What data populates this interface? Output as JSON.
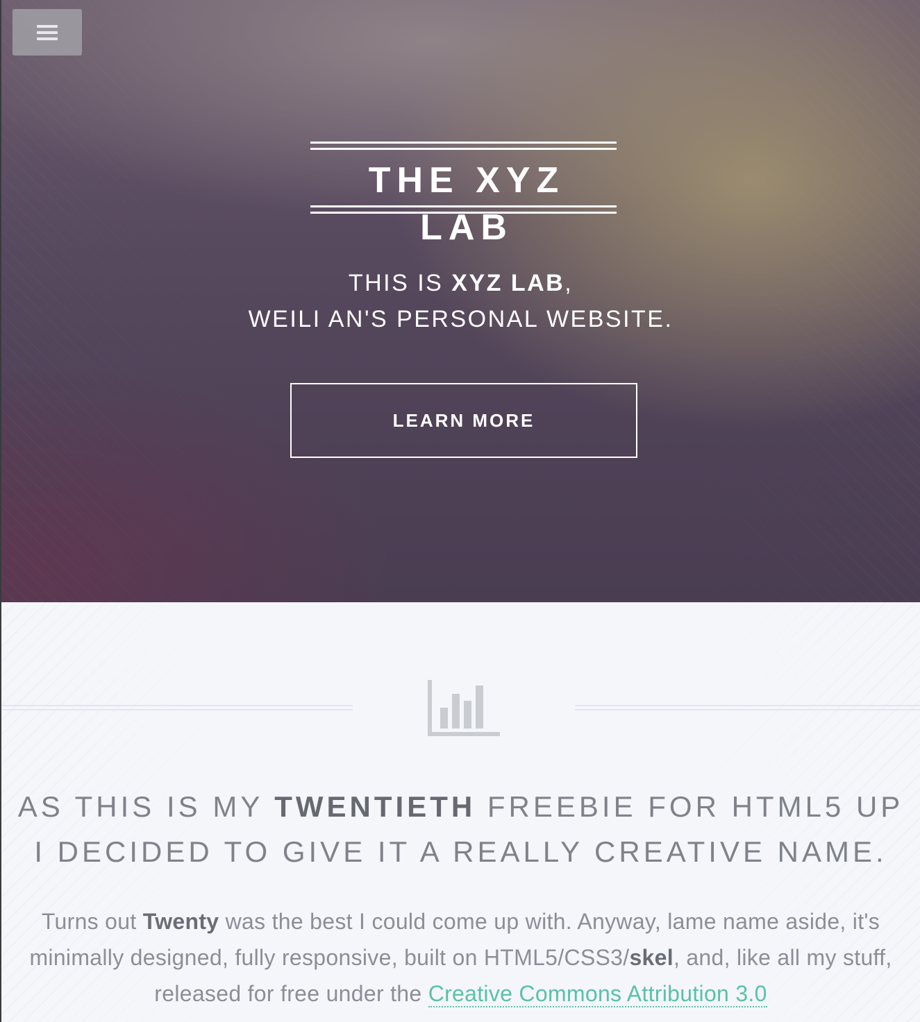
{
  "nav": {
    "menu_icon": "hamburger-menu-icon"
  },
  "hero": {
    "logo_title": "THE XYZ LAB",
    "tagline_line1_prefix": "THIS IS ",
    "tagline_line1_strong": "XYZ LAB",
    "tagline_line1_suffix": ",",
    "tagline_line2": "WEILI AN'S PERSONAL WEBSITE.",
    "button_label": "LEARN MORE"
  },
  "main": {
    "icon": "bar-chart-icon",
    "headline_line1_prefix": "AS THIS IS MY ",
    "headline_line1_strong": "TWENTIETH",
    "headline_line1_suffix": " FREEBIE FOR HTML5 UP",
    "headline_line2": "I DECIDED TO GIVE IT A REALLY CREATIVE NAME.",
    "body_part1": "Turns out ",
    "body_strong1": "Twenty",
    "body_part2": " was the best I could come up with. Anyway, lame name aside, it's minimally designed, fully responsive, built on HTML5/CSS3/",
    "body_strong2": "skel",
    "body_part3": ", and, like all my stuff, released for free under the ",
    "body_link": "Creative Commons Attribution 3.0"
  },
  "colors": {
    "hero_bg": "#55475b",
    "main_bg": "#f4f6fa",
    "accent_link": "#5ac1a9",
    "headline_text": "#7f8389"
  }
}
